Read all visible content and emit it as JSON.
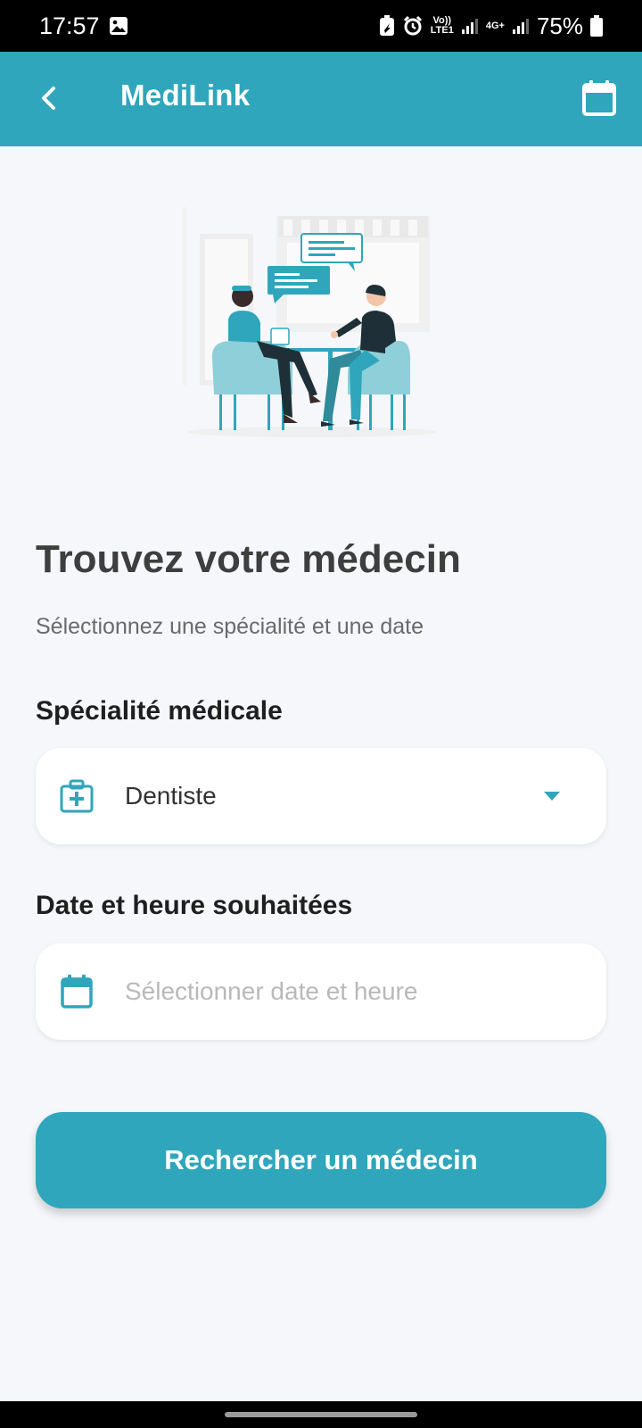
{
  "status_bar": {
    "time": "17:57",
    "gallery_icon": "image-icon",
    "volte_top": "Vo))",
    "volte_bottom": "LTE1",
    "network": "4G+",
    "battery": "75%"
  },
  "app_bar": {
    "title": "MediLink",
    "back_icon": "chevron-left-icon",
    "calendar_icon": "calendar-icon",
    "color": "#2fa6bb"
  },
  "illustration": {
    "name": "doctor-consultation-illustration"
  },
  "main": {
    "title": "Trouvez votre médecin",
    "subtitle": "Sélectionnez une spécialité et une date"
  },
  "specialty": {
    "label": "Spécialité médicale",
    "value": "Dentiste",
    "icon": "medical-kit-icon"
  },
  "datetime": {
    "label": "Date et heure souhaitées",
    "placeholder": "Sélectionner date et heure",
    "icon": "calendar-icon"
  },
  "search_button": {
    "label": "Rechercher un médecin"
  },
  "colors": {
    "accent": "#2fa6bb",
    "background": "#f5f7fa",
    "title_text": "#3e3e3e"
  }
}
